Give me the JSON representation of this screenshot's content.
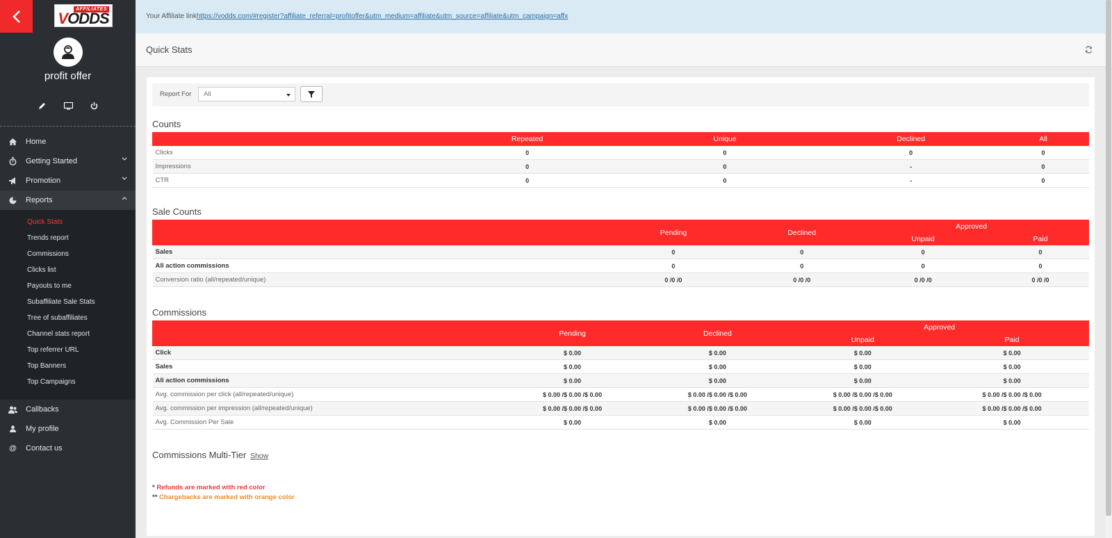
{
  "sidebar": {
    "logo_top": "AFFILIATES",
    "logo_v": "V",
    "logo_rest": "ODDS",
    "username": "profit offer",
    "nav": [
      {
        "label": "Home",
        "icon": "home-icon"
      },
      {
        "label": "Getting Started",
        "icon": "stopwatch-icon"
      },
      {
        "label": "Promotion",
        "icon": "bullhorn-icon"
      },
      {
        "label": "Reports",
        "icon": "pie-chart-icon"
      }
    ],
    "reports_sub": [
      "Quick Stats",
      "Trends report",
      "Commissions",
      "Clicks list",
      "Payouts to me",
      "Subaffiliate Sale Stats",
      "Tree of subaffiliates",
      "Channel stats report",
      "Top referrer URL",
      "Top Banners",
      "Top Campaigns"
    ],
    "nav_bottom": [
      {
        "label": "Callbacks",
        "icon": "users-icon"
      },
      {
        "label": "My profile",
        "icon": "user-icon"
      },
      {
        "label": "Contact us",
        "icon": "at-icon"
      }
    ]
  },
  "affiliate": {
    "prefix": "Your Affiliate link",
    "link": "https://vodds.com/#register?affiliate_referral=profitoffer&utm_medium=affiliate&utm_source=affiliate&utm_campaign=affx"
  },
  "page": {
    "title": "Quick Stats"
  },
  "filter": {
    "label": "Report For",
    "selected": "All"
  },
  "counts": {
    "title": "Counts",
    "headers": [
      "Repeated",
      "Unique",
      "Declined",
      "All"
    ],
    "rows": [
      {
        "label": "Clicks",
        "values": [
          "0",
          "0",
          "0",
          "0"
        ]
      },
      {
        "label": "Impressions",
        "values": [
          "0",
          "0",
          "-",
          "0"
        ]
      },
      {
        "label": "CTR",
        "values": [
          "0",
          "0",
          "-",
          "0"
        ]
      }
    ]
  },
  "sale_counts": {
    "title": "Sale Counts",
    "headers": {
      "pending": "Pending",
      "declined": "Declined",
      "approved": "Approved",
      "unpaid": "Unpaid",
      "paid": "Paid"
    },
    "rows": [
      {
        "label": "Sales",
        "values": [
          "0",
          "0",
          "0",
          "0"
        ]
      },
      {
        "label": "All action commissions",
        "values": [
          "0",
          "0",
          "0",
          "0"
        ]
      },
      {
        "label": "Conversion ratio (all/repeated/unique)",
        "values": [
          "0 /0 /0",
          "0 /0 /0",
          "0 /0 /0",
          "0 /0 /0"
        ]
      }
    ]
  },
  "commissions": {
    "title": "Commissions",
    "headers": {
      "pending": "Pending",
      "declined": "Declined",
      "approved": "Approved",
      "unpaid": "Unpaid",
      "paid": "Paid"
    },
    "rows": [
      {
        "label": "Click",
        "values": [
          "$ 0.00",
          "$ 0.00",
          "$ 0.00",
          "$ 0.00"
        ]
      },
      {
        "label": "Sales",
        "values": [
          "$ 0.00",
          "$ 0.00",
          "$ 0.00",
          "$ 0.00"
        ]
      },
      {
        "label": "All action commissions",
        "values": [
          "$ 0.00",
          "$ 0.00",
          "$ 0.00",
          "$ 0.00"
        ]
      },
      {
        "label": "Avg. commission per click (all/repeated/unique)",
        "values": [
          "$ 0.00 /$ 0.00 /$ 0.00",
          "$ 0.00 /$ 0.00 /$ 0.00",
          "$ 0.00 /$ 0.00 /$ 0.00",
          "$ 0.00 /$ 0.00 /$ 0.00"
        ]
      },
      {
        "label": "Avg. commission per impression (all/repeated/unique)",
        "values": [
          "$ 0.00 /$ 0.00 /$ 0.00",
          "$ 0.00 /$ 0.00 /$ 0.00",
          "$ 0.00 /$ 0.00 /$ 0.00",
          "$ 0.00 /$ 0.00 /$ 0.00"
        ]
      },
      {
        "label": "Avg. Commission Per Sale",
        "values": [
          "$ 0.00",
          "$ 0.00",
          "$ 0.00",
          "$ 0.00"
        ]
      }
    ]
  },
  "multitier": {
    "title": "Commissions Multi-Tier",
    "show": "Show"
  },
  "notes": {
    "refunds_mark": "*",
    "refunds": "Refunds are marked with red color",
    "chargebacks_mark": "**",
    "chargebacks": "Chargebacks are marked with orange color"
  },
  "colors": {
    "accent": "#ff2a2a",
    "sidebar": "#2b2f33",
    "affbar": "#d9eaf4"
  }
}
